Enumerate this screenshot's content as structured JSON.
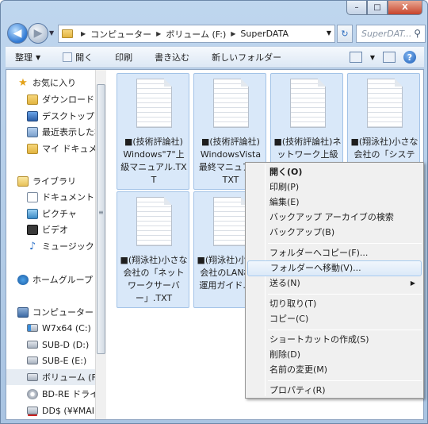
{
  "caption": {
    "minimize": "–",
    "maximize": "□",
    "close": "X"
  },
  "nav": {
    "back": "◀",
    "forward": "▶",
    "history_arrow": "▼",
    "refresh": "↻"
  },
  "address": {
    "segments": [
      "コンピューター",
      "ボリューム (F:)",
      "SuperDATA"
    ],
    "separator": "▶",
    "dropdown": "▼"
  },
  "search": {
    "placeholder": "SuperDAT...",
    "icon": "search-icon"
  },
  "toolbar": {
    "organize": "整理",
    "open": "開く",
    "print": "印刷",
    "burn": "書き込む",
    "new_folder": "新しいフォルダー",
    "help": "?"
  },
  "navpane": {
    "favorites": "お気に入り",
    "downloads": "ダウンロード",
    "desktop": "デスクトップ",
    "recent": "最近表示した場",
    "mydocs": "マイ ドキュメント",
    "libraries": "ライブラリ",
    "documents": "ドキュメント",
    "pictures": "ピクチャ",
    "videos": "ビデオ",
    "music": "ミュージック",
    "homegroup": "ホームグループ",
    "computer": "コンピューター",
    "drive_c": "W7x64 (C:)",
    "drive_d": "SUB-D (D:)",
    "drive_e": "SUB-E (E:)",
    "drive_f": "ボリューム (F:)",
    "drive_bd": "BD-RE ドライブ",
    "drive_net": "DD$ (¥¥MAIN"
  },
  "files": [
    {
      "name": "■(技術評論社) Windows\"7\"上級マニュアル.TXT"
    },
    {
      "name": "■(技術評論社) WindowsVista最終マニュアル.TXT"
    },
    {
      "name": "■(技術評論社)ネットワーク上級"
    },
    {
      "name": "■(翔泳社)小さな会社の「システム"
    },
    {
      "name": "■(翔泳社)小さな会社の「ネットワークサーバー」.TXT"
    },
    {
      "name": "■(翔泳社)小さな会社のLAN構築運用ガイド.TXT"
    }
  ],
  "context_menu": {
    "open": "開く(O)",
    "print": "印刷(P)",
    "edit": "編集(E)",
    "backup_search": "バックアップ アーカイブの検索",
    "backup": "バックアップ(B)",
    "copy_to": "フォルダーへコピー(F)...",
    "move_to": "フォルダーへ移動(V)...",
    "send_to": "送る(N)",
    "submenu_arrow": "▶",
    "cut": "切り取り(T)",
    "copy": "コピー(C)",
    "shortcut": "ショートカットの作成(S)",
    "delete": "削除(D)",
    "rename": "名前の変更(M)",
    "properties": "プロパティ(R)"
  }
}
